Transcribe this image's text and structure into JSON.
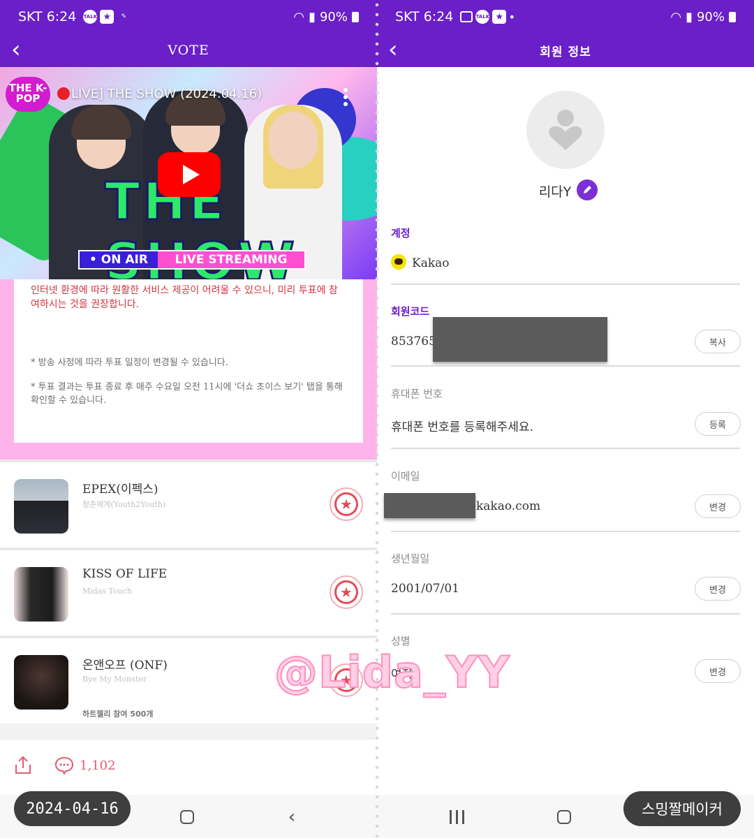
{
  "left": {
    "status": {
      "carrier": "SKT 6:24",
      "battery": "90%"
    },
    "appbar": {
      "title": "VOTE"
    },
    "video": {
      "channel_logo": "THE K-POP",
      "title": "LIVE] THE SHOW (2024.04.16)",
      "show_text": "THE SHOW",
      "on_air": "• ON AIR",
      "live_streaming": "LIVE STREAMING"
    },
    "notice": {
      "red_text": "인터넷 환경에 따라 원활한 서비스 제공이 어려울 수 있으니, 미리 투표에 참여하시는 것을 권장합니다.",
      "gray1": "* 방송 사정에 따라 투표 일정이 변경될 수 있습니다.",
      "gray2": "* 투표 결과는 투표 종료 후 매주 수요일 오전 11시에 '더쇼 초이스 보기' 탭을 통해 확인할 수 있습니다."
    },
    "artists": [
      {
        "name": "EPEX(이펙스)",
        "song": "청춘에게(Youth2Youth)"
      },
      {
        "name": "KISS OF LIFE",
        "song": "Midas Touch"
      },
      {
        "name": "온앤오프 (ONF)",
        "song": "Bye My Monster",
        "heart": "하트젤리 참여 500개"
      }
    ],
    "comment_count": "1,102",
    "date_chip": "2024-04-16"
  },
  "right": {
    "status": {
      "carrier": "SKT 6:24",
      "battery": "90%"
    },
    "appbar": {
      "title": "회원 정보"
    },
    "nickname": "리다Y",
    "account_label": "계정",
    "account_value": "Kakao",
    "member_code_label": "회원코드",
    "member_code_value": "853765",
    "copy_button": "복사",
    "phone_label": "휴대폰 번호",
    "phone_value": "휴대폰 번호를 등록해주세요.",
    "register_button": "등록",
    "email_label": "이메일",
    "email_value": "kakao.com",
    "change_button": "변경",
    "birth_label": "생년월일",
    "birth_value": "2001/07/01",
    "gender_label": "성별",
    "gender_value": "여자",
    "maker_chip": "스밍짤메이커"
  },
  "watermark": "@Lida_YY",
  "colors": {
    "brand_purple": "#6a1fc8",
    "vote_red": "#e84a55",
    "kakao_yellow": "#f7e200"
  }
}
